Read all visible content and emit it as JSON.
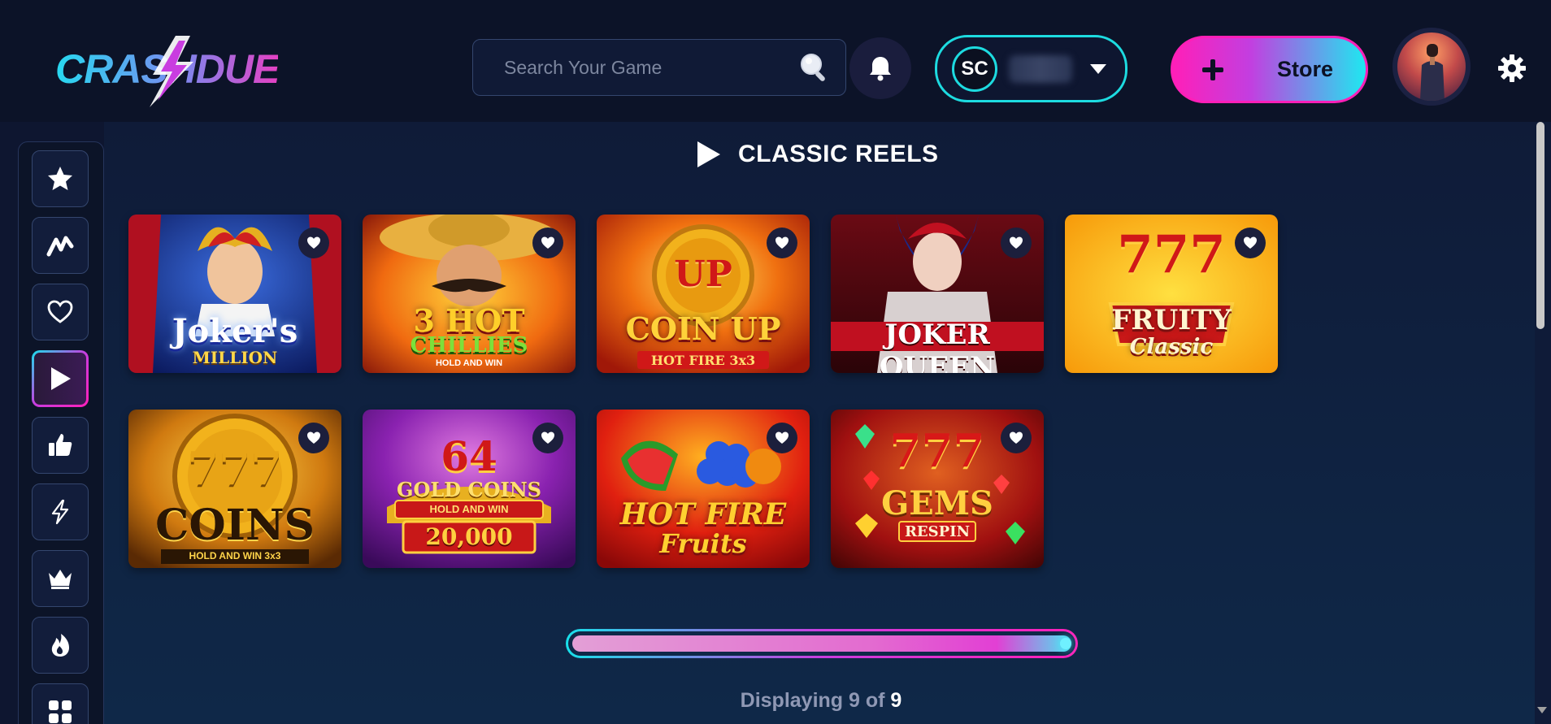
{
  "header": {
    "logo_text": "CRASHDUEL",
    "search": {
      "placeholder": "Search Your Game",
      "value": ""
    },
    "currency": {
      "badge": "SC"
    },
    "store_label": "Store"
  },
  "sidebar": {
    "items": [
      {
        "icon": "star-icon"
      },
      {
        "icon": "trend-icon"
      },
      {
        "icon": "heart-icon"
      },
      {
        "icon": "play-icon",
        "active": true
      },
      {
        "icon": "thumbs-up-icon"
      },
      {
        "icon": "lightning-icon"
      },
      {
        "icon": "crown-icon"
      },
      {
        "icon": "flame-icon"
      },
      {
        "icon": "grid-icon"
      }
    ]
  },
  "section": {
    "title": "CLASSIC REELS"
  },
  "games": [
    {
      "name": "Joker's Million",
      "line1": "Joker's",
      "line2": "MILLION"
    },
    {
      "name": "3 Hot Chillies",
      "line1": "3 HOT",
      "line2": "CHILLIES",
      "line3": "HOLD AND WIN"
    },
    {
      "name": "Coin Up Hot Fire",
      "line1": "COIN UP",
      "line2": "HOT FIRE 3x3"
    },
    {
      "name": "Joker Queen",
      "line1": "JOKER QUEEN"
    },
    {
      "name": "Fruity Classic",
      "line1": "777",
      "line2": "FRUITY",
      "line3": "Classic"
    },
    {
      "name": "777 Coins",
      "line1": "777",
      "line2": "COINS",
      "line3": "HOLD AND WIN 3x3"
    },
    {
      "name": "64 Gold Coins",
      "line1": "64",
      "line2": "GOLD COINS",
      "line3": "HOLD AND WIN",
      "line4": "20,000"
    },
    {
      "name": "Hot Fire Fruits",
      "line1": "HOT FIRE",
      "line2": "Fruits"
    },
    {
      "name": "777 Gems Respin",
      "line1": "777",
      "line2": "GEMS",
      "line3": "RESPIN"
    }
  ],
  "pagination": {
    "progress": 1.0,
    "prefix": "Displaying 9 of",
    "total": "9"
  },
  "colors": {
    "accent_cyan": "#1ddbe0",
    "accent_pink": "#ff1fb8",
    "background": "#0e1630"
  }
}
